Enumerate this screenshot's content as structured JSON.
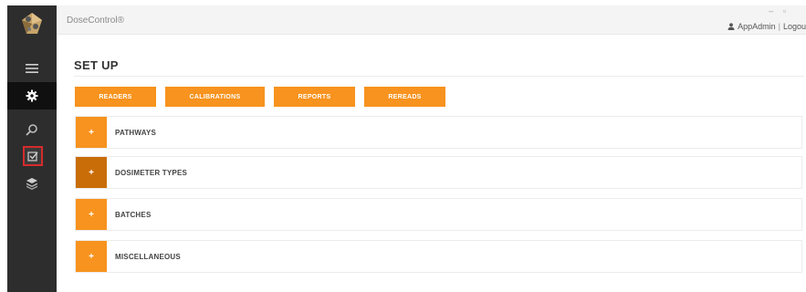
{
  "app": {
    "brand": "DoseControl®",
    "window_controls": "– ▫"
  },
  "user": {
    "name": "AppAdmin",
    "separator": "|",
    "logout_label": "Logou"
  },
  "sidebar": {
    "items": [
      {
        "icon": "menu-icon"
      },
      {
        "icon": "gear-icon",
        "active": true
      },
      {
        "icon": "search-icon"
      },
      {
        "icon": "checkbox-icon",
        "highlighted": true
      },
      {
        "icon": "layers-icon"
      }
    ]
  },
  "page": {
    "title": "SET UP"
  },
  "tabs": [
    {
      "label": "READERS"
    },
    {
      "label": "CALIBRATIONS"
    },
    {
      "label": "REPORTS"
    },
    {
      "label": "REREADS"
    }
  ],
  "sections": [
    {
      "label": "PATHWAYS",
      "toggle": "+"
    },
    {
      "label": "DOSIMETER TYPES",
      "toggle": "+",
      "expanded": true
    },
    {
      "label": "BATCHES",
      "toggle": "+"
    },
    {
      "label": "MISCELLANEOUS",
      "toggle": "+"
    }
  ],
  "colors": {
    "accent": "#f7931e",
    "accent_dark": "#c96d08",
    "sidebar_bg": "#2d2d2d",
    "highlight": "#d62b2b"
  }
}
